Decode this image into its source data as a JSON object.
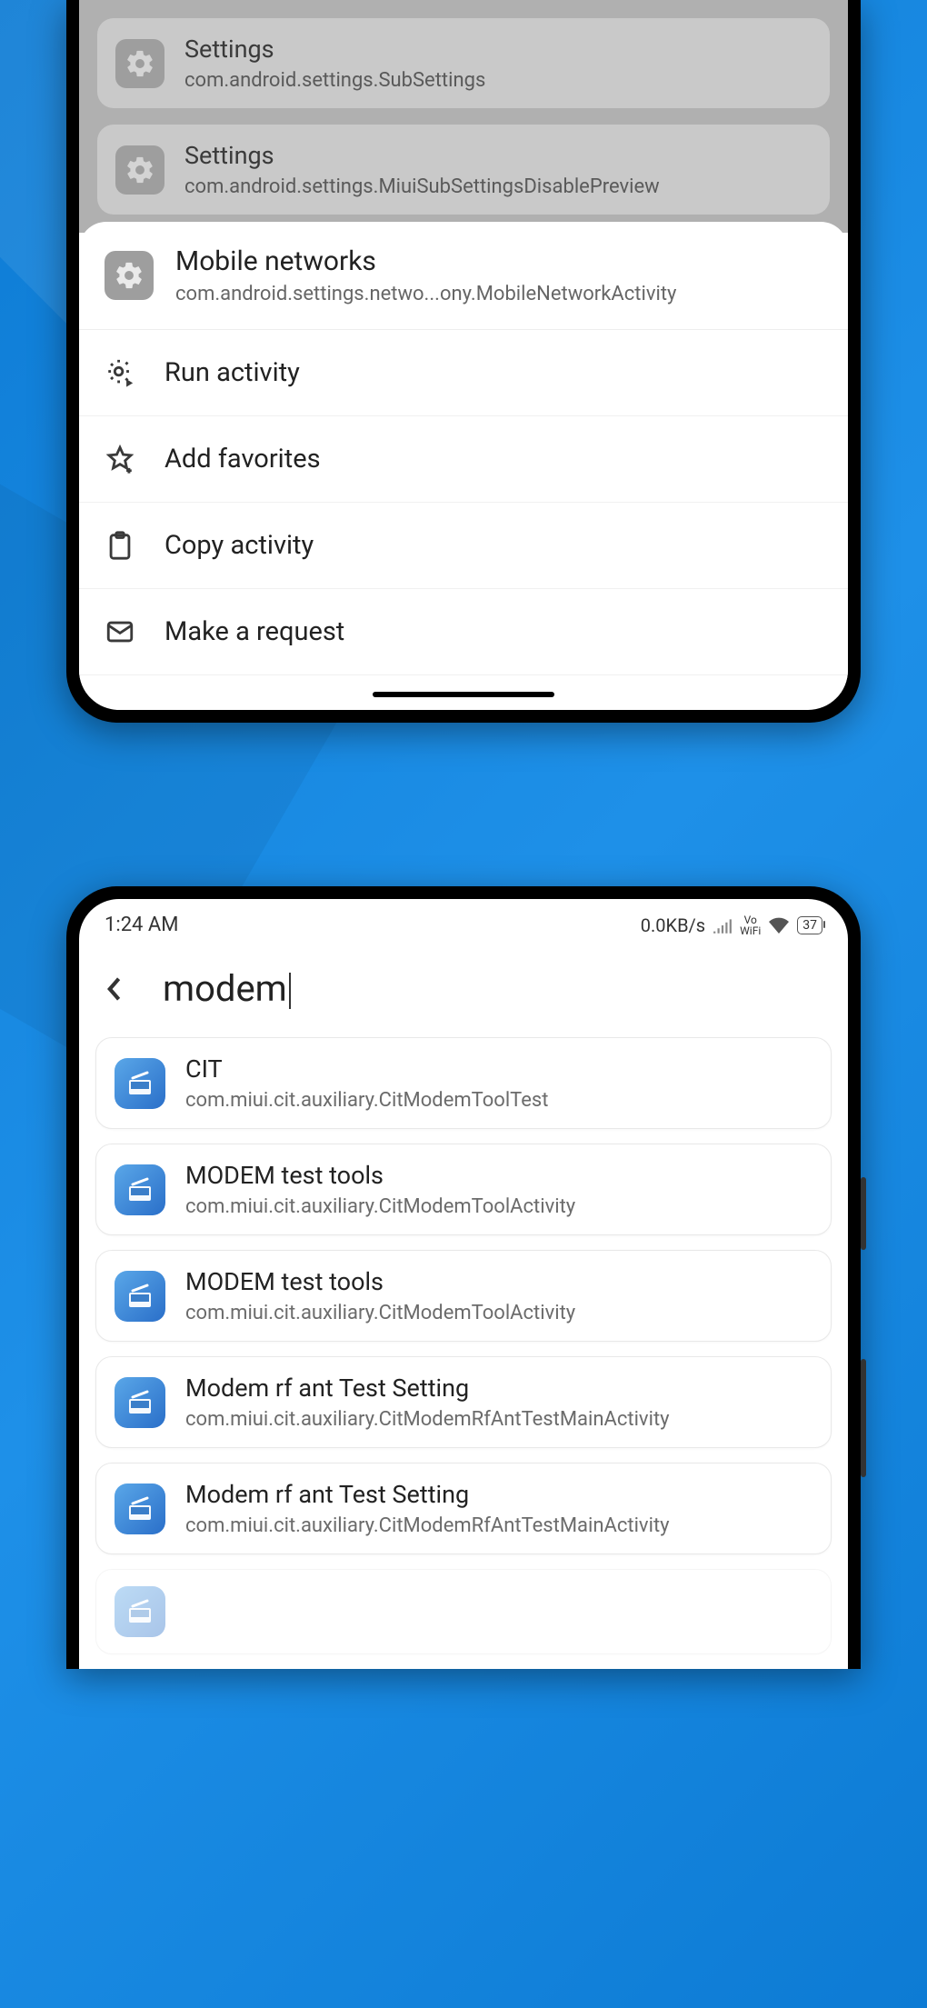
{
  "phone1": {
    "dimmed_items": [
      {
        "title": "Settings",
        "sub": "com.android.settings.SubSettings"
      },
      {
        "title": "Settings",
        "sub": "com.android.settings.MiuiSubSettingsDisablePreview"
      }
    ],
    "sheet_header": {
      "title": "Mobile networks",
      "sub": "com.android.settings.netwo...ony.MobileNetworkActivity"
    },
    "sheet_actions": {
      "run": "Run activity",
      "fav": "Add favorites",
      "copy": "Copy activity",
      "request": "Make a request"
    }
  },
  "phone2": {
    "status": {
      "time": "1:24 AM",
      "speed": "0.0KB/s",
      "vo": "Vo",
      "wifi_label": "WiFi",
      "battery": "37"
    },
    "search_query": "modem",
    "results": [
      {
        "title": "CIT",
        "sub": "com.miui.cit.auxiliary.CitModemToolTest"
      },
      {
        "title": "MODEM test tools",
        "sub": "com.miui.cit.auxiliary.CitModemToolActivity"
      },
      {
        "title": "MODEM test tools",
        "sub": "com.miui.cit.auxiliary.CitModemToolActivity"
      },
      {
        "title": "Modem rf ant Test Setting",
        "sub": "com.miui.cit.auxiliary.CitModemRfAntTestMainActivity"
      },
      {
        "title": "Modem rf ant Test Setting",
        "sub": "com.miui.cit.auxiliary.CitModemRfAntTestMainActivity"
      }
    ]
  }
}
